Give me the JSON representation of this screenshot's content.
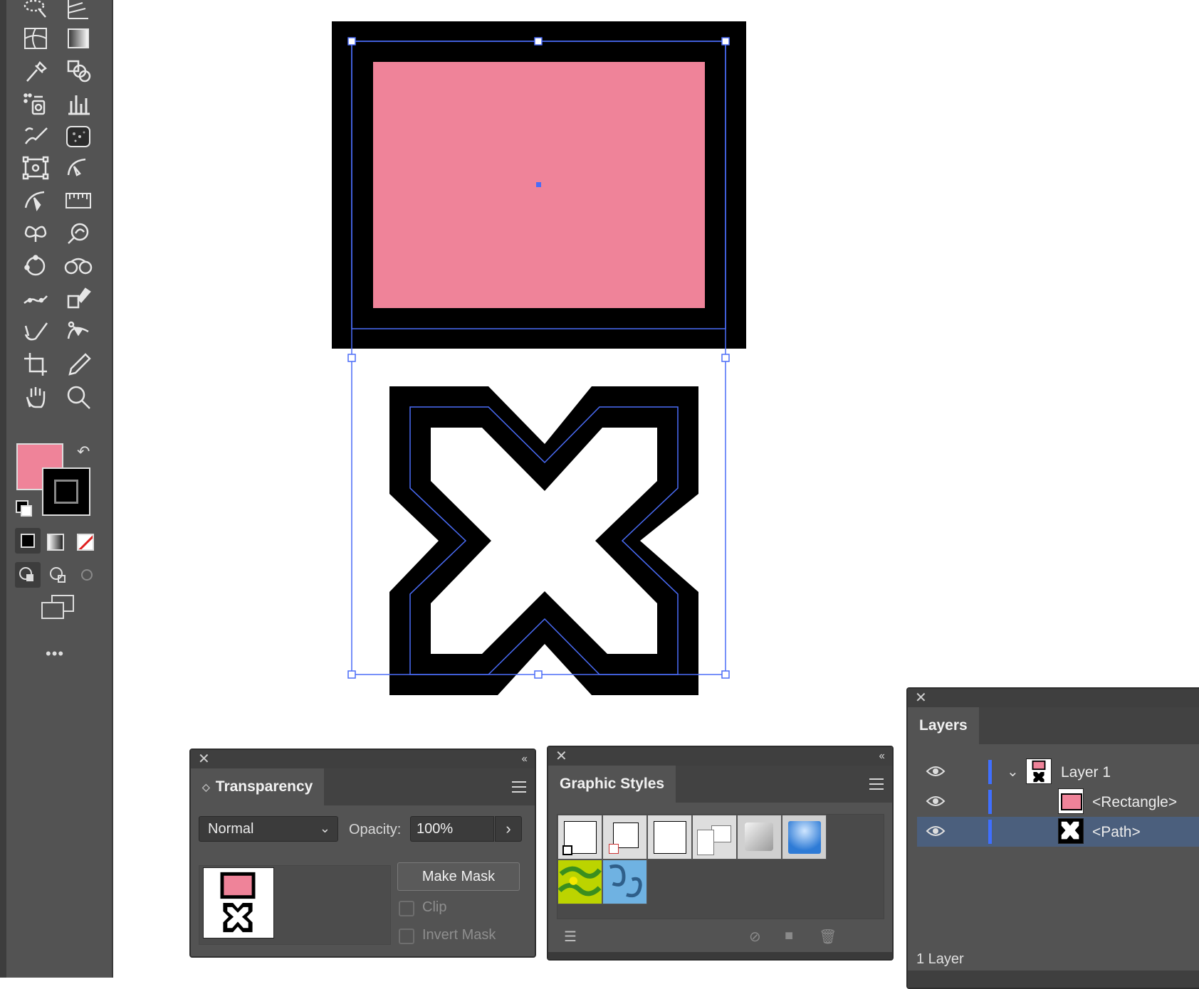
{
  "toolbar": {
    "tools": [
      "lasso-select-icon",
      "perspective-grid-icon",
      "mesh-icon",
      "gradient-icon",
      "eyedropper-icon",
      "shape-builder-icon",
      "symbol-sprayer-icon",
      "column-graph-icon",
      "blob-brush-icon",
      "texture-icon",
      "free-transform-icon",
      "warp-icon",
      "width-tool-icon",
      "ruler-icon",
      "puppet-warp-icon",
      "zoom-lens-icon",
      "rotate-circle-icon",
      "blend-icon",
      "smooth-path-icon",
      "live-paint-select-icon",
      "shaper-icon",
      "curvature-icon",
      "artboard-icon",
      "pencil-icon",
      "hand-icon",
      "zoom-icon"
    ],
    "fill_color": "#ef8399",
    "stroke_color": "#000000",
    "more_label": "•••"
  },
  "artwork": {
    "rectangle_fill": "#ef8399",
    "stroke": "#000000",
    "selection_color": "#4a6cf7"
  },
  "transparency": {
    "title": "Transparency",
    "blend_mode": "Normal",
    "opacity_label": "Opacity:",
    "opacity_value": "100%",
    "make_mask_label": "Make Mask",
    "clip_label": "Clip",
    "invert_mask_label": "Invert Mask"
  },
  "graphic_styles": {
    "title": "Graphic Styles",
    "swatches": [
      "default-style",
      "no-fill-style",
      "white-style",
      "red-slash-style",
      "soft-shadow-style",
      "blue-gradient-style",
      "yellow-green-pattern-style",
      "blue-swirl-pattern-style"
    ]
  },
  "layers": {
    "title": "Layers",
    "rows": [
      {
        "label": "Layer 1"
      },
      {
        "label": "<Rectangle>"
      },
      {
        "label": "<Path>"
      }
    ],
    "footer": "1 Layer"
  }
}
